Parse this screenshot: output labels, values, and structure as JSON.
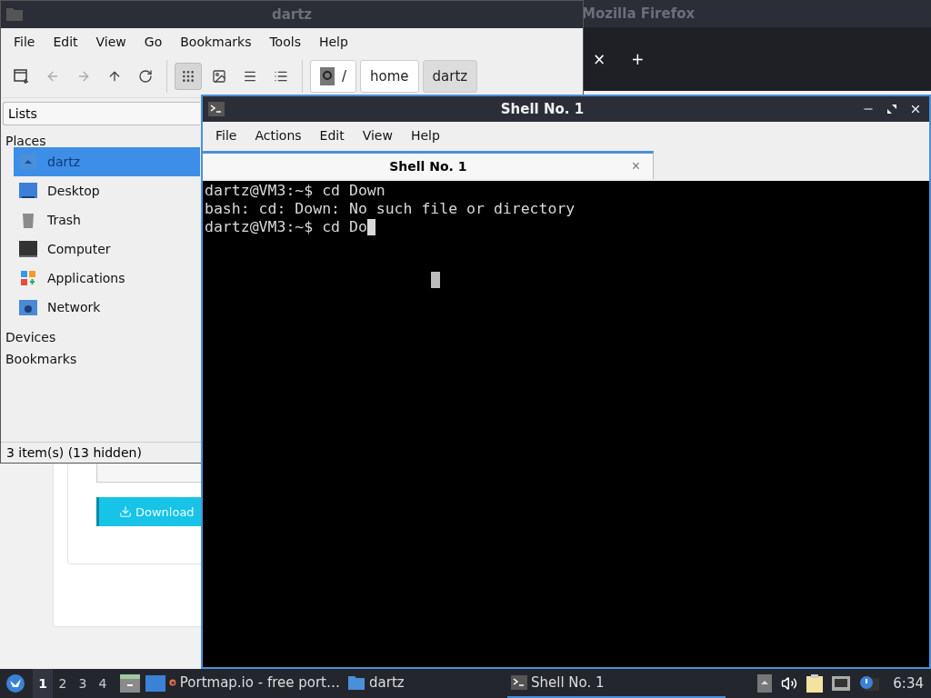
{
  "firefox": {
    "title": "Mozilla Firefox",
    "tab_close": "×",
    "new_tab": "+",
    "download_button": "Download"
  },
  "file_manager": {
    "title": "dartz",
    "menu": [
      "File",
      "Edit",
      "View",
      "Go",
      "Bookmarks",
      "Tools",
      "Help"
    ],
    "view_modes": [
      {
        "kind": "icons",
        "selected": true
      },
      {
        "kind": "thumbnails",
        "selected": false
      },
      {
        "kind": "compact",
        "selected": false
      },
      {
        "kind": "detailed",
        "selected": false
      }
    ],
    "path": [
      {
        "label": "/",
        "kind": "root",
        "selected": false
      },
      {
        "label": "home",
        "kind": "folder",
        "selected": false
      },
      {
        "label": "dartz",
        "kind": "folder",
        "selected": true
      }
    ],
    "side_pane_mode": "Lists",
    "sections": [
      {
        "label": "Places",
        "items": [
          {
            "label": "dartz",
            "kind": "home",
            "selected": true
          },
          {
            "label": "Desktop",
            "kind": "desktop",
            "selected": false
          },
          {
            "label": "Trash",
            "kind": "trash",
            "selected": false
          },
          {
            "label": "Computer",
            "kind": "computer",
            "selected": false
          },
          {
            "label": "Applications",
            "kind": "applications",
            "selected": false
          },
          {
            "label": "Network",
            "kind": "network",
            "selected": false
          }
        ]
      },
      {
        "label": "Devices"
      },
      {
        "label": "Bookmarks"
      }
    ],
    "status": "3 item(s) (13 hidden)"
  },
  "terminal": {
    "title": "Shell No. 1",
    "menu": [
      "File",
      "Actions",
      "Edit",
      "View",
      "Help"
    ],
    "tab": {
      "label": "Shell No. 1",
      "close": "×"
    },
    "lines": [
      "dartz@VM3:~$ cd Down",
      "bash: cd: Down: No such file or directory",
      "dartz@VM3:~$ cd Do"
    ]
  },
  "taskbar": {
    "workspaces": [
      {
        "label": "1",
        "selected": true
      },
      {
        "label": "2",
        "selected": false
      },
      {
        "label": "3",
        "selected": false
      },
      {
        "label": "4",
        "selected": false
      }
    ],
    "tasks": [
      {
        "label": "Portmap.io - free port…",
        "kind": "firefox",
        "selected": false
      },
      {
        "label": "dartz",
        "kind": "folder",
        "selected": false
      },
      {
        "label": "Shell No. 1",
        "kind": "terminal",
        "selected": true
      }
    ],
    "clock": "6:34"
  }
}
